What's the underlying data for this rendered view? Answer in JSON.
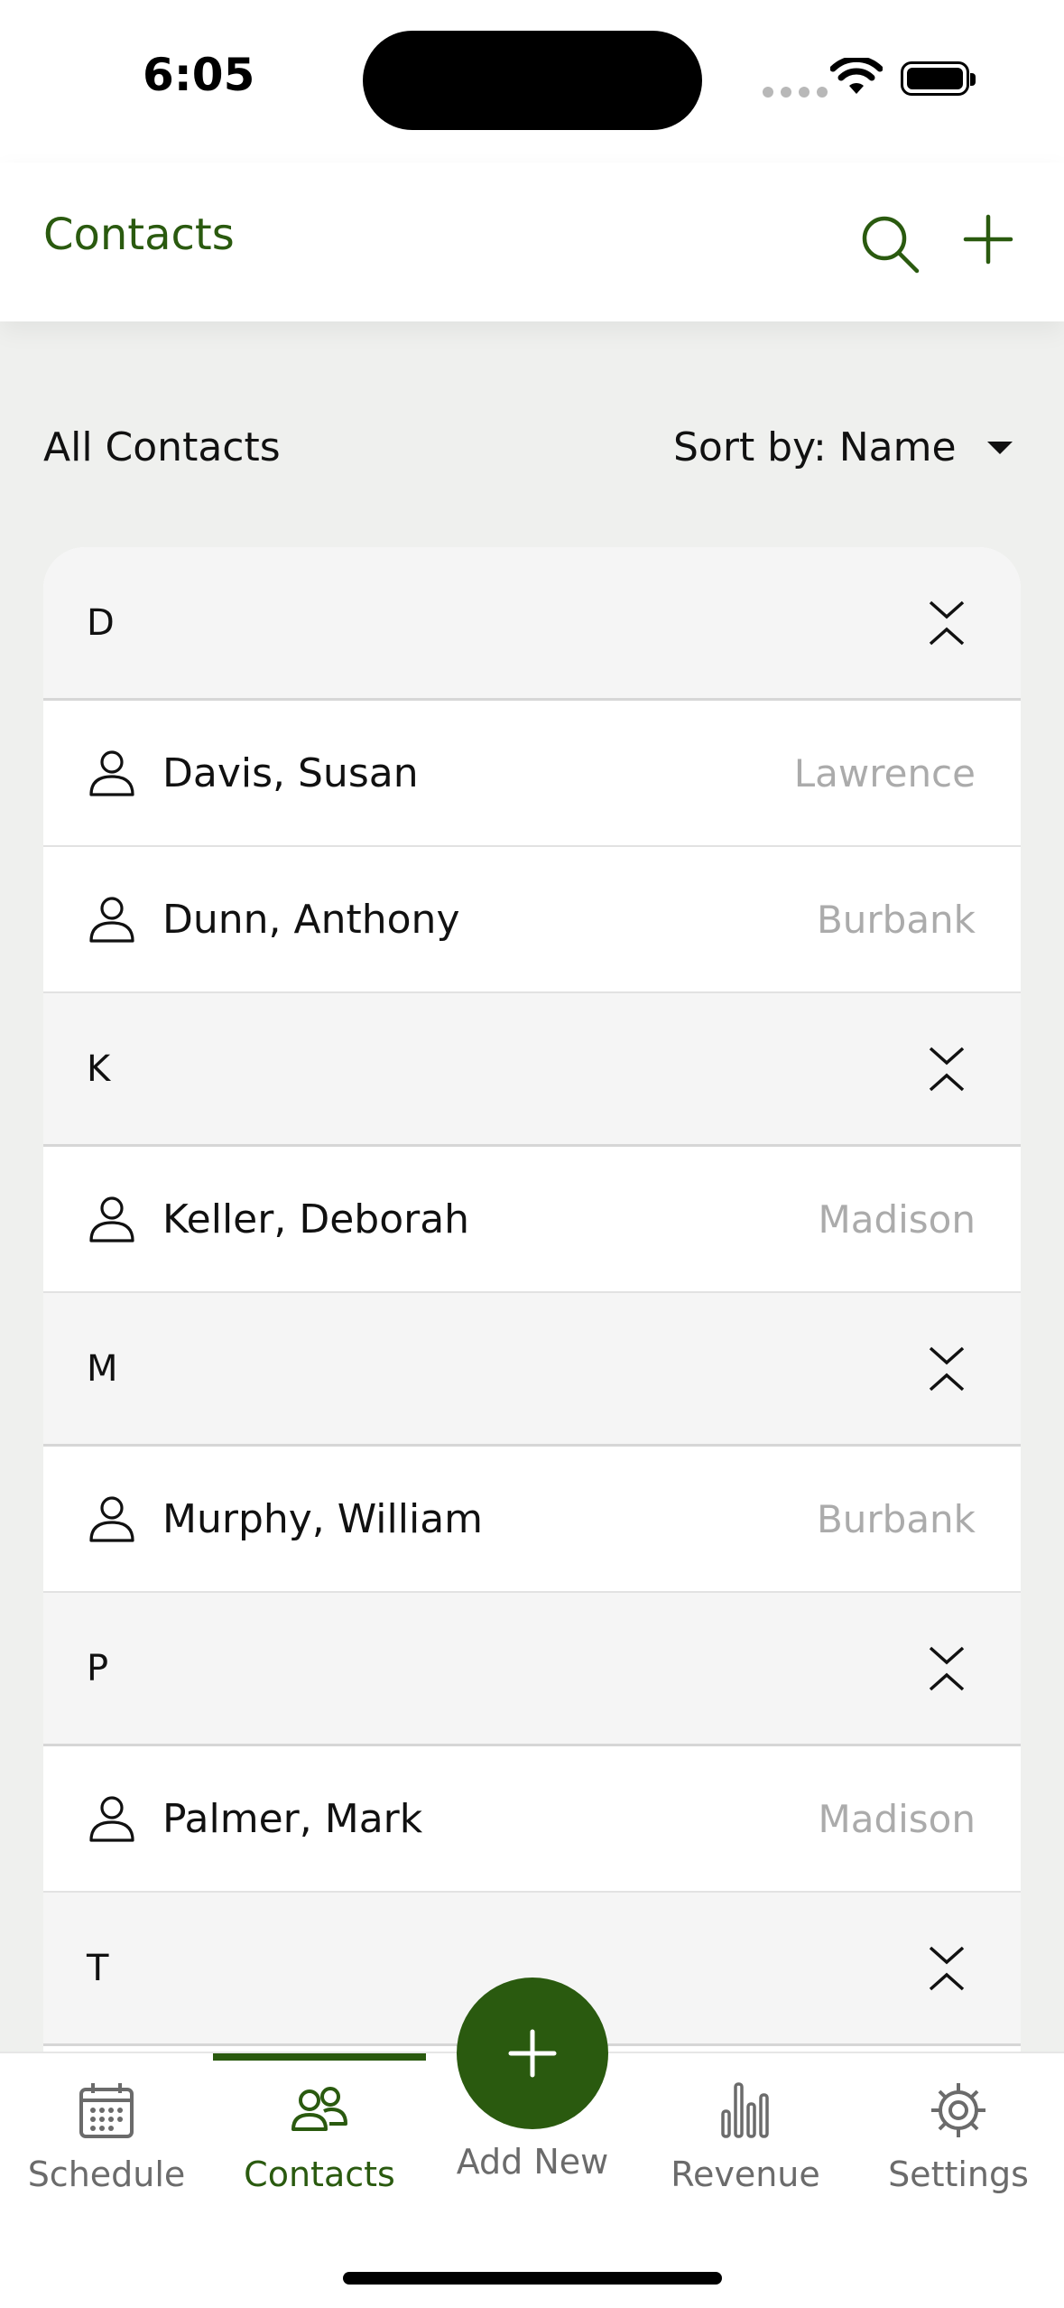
{
  "status": {
    "time": "6:05"
  },
  "header": {
    "title": "Contacts"
  },
  "list": {
    "title": "All Contacts",
    "sort_label": "Sort by: Name"
  },
  "sections": [
    {
      "letter": "D",
      "contacts": [
        {
          "name": "Davis, Susan",
          "city": "Lawrence"
        },
        {
          "name": "Dunn, Anthony",
          "city": "Burbank"
        }
      ]
    },
    {
      "letter": "K",
      "contacts": [
        {
          "name": "Keller, Deborah",
          "city": "Madison"
        }
      ]
    },
    {
      "letter": "M",
      "contacts": [
        {
          "name": "Murphy, William",
          "city": "Burbank"
        }
      ]
    },
    {
      "letter": "P",
      "contacts": [
        {
          "name": "Palmer, Mark",
          "city": "Madison"
        }
      ]
    },
    {
      "letter": "T",
      "contacts": []
    }
  ],
  "tabs": [
    {
      "label": "Schedule",
      "icon": "calendar-icon"
    },
    {
      "label": "Contacts",
      "icon": "people-icon",
      "active": true
    },
    {
      "label": "Add New",
      "icon": "plus-icon"
    },
    {
      "label": "Revenue",
      "icon": "bar-chart-icon"
    },
    {
      "label": "Settings",
      "icon": "gear-icon"
    }
  ],
  "colors": {
    "accent": "#2a5a0f",
    "muted": "#ababab",
    "background": "#eff0ee"
  }
}
